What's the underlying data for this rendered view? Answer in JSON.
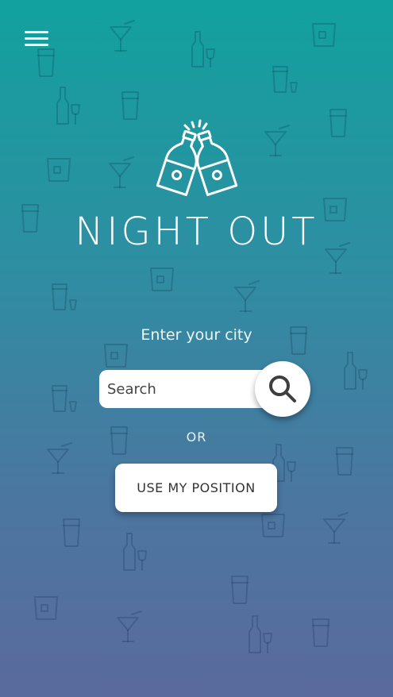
{
  "app": {
    "title": "NIGHT OUT"
  },
  "menu": {
    "icon": "hamburger-menu-icon"
  },
  "search": {
    "label": "Enter your city",
    "placeholder": "Search",
    "icon": "search-icon"
  },
  "or_label": "OR",
  "position_button": {
    "label": "USE MY POSITION"
  },
  "colors": {
    "gradient_top": "#12a19e",
    "gradient_bottom": "#5a6a9c",
    "text": "#ffffff",
    "button_bg": "#ffffff",
    "button_text": "#333333"
  }
}
